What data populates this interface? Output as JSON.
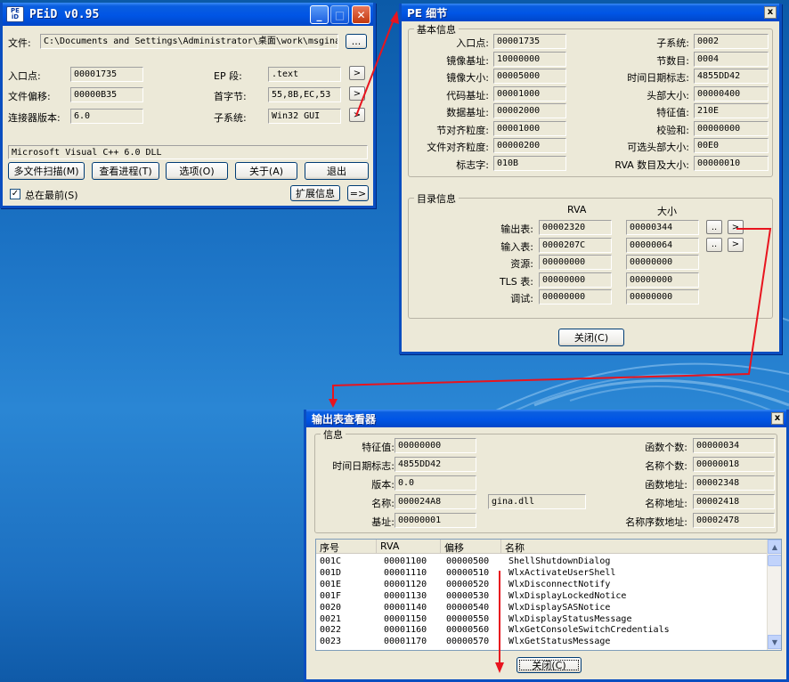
{
  "main": {
    "title": "PEiD v0.95",
    "logo": "PE iD",
    "minimize_glyph": "_",
    "maximize_glyph": "□",
    "close_glyph": "✕",
    "file_label": "文件:",
    "file_path": "C:\\Documents and Settings\\Administrator\\桌面\\work\\msgina.dll",
    "browse_label": "...",
    "entry_label": "入口点:",
    "entry_value": "00001735",
    "ep_section_label": "EP 段:",
    "ep_section_value": ".text",
    "file_offset_label": "文件偏移:",
    "file_offset_value": "00000B35",
    "first_bytes_label": "首字节:",
    "first_bytes_value": "55,8B,EC,53",
    "linker_label": "连接器版本:",
    "linker_value": "6.0",
    "subsystem_label": "子系统:",
    "subsystem_value": "Win32 GUI",
    "arrow_glyph": ">",
    "detection": "Microsoft Visual C++ 6.0 DLL",
    "btn_multiscan": "多文件扫描(M)",
    "btn_process": "查看进程(T)",
    "btn_options": "选项(O)",
    "btn_about": "关于(A)",
    "btn_exit": "退出",
    "check_mark": "✓",
    "stay_on_top": "总在最前(S)",
    "btn_ext_info": "扩展信息",
    "btn_next": "=>"
  },
  "pe": {
    "title": "PE 细节",
    "close_glyph": "x",
    "basic_group": "基本信息",
    "left_fields": [
      {
        "label": "入口点:",
        "value": "00001735"
      },
      {
        "label": "镜像基址:",
        "value": "10000000"
      },
      {
        "label": "镜像大小:",
        "value": "00005000"
      },
      {
        "label": "代码基址:",
        "value": "00001000"
      },
      {
        "label": "数据基址:",
        "value": "00002000"
      },
      {
        "label": "节对齐粒度:",
        "value": "00001000"
      },
      {
        "label": "文件对齐粒度:",
        "value": "00000200"
      },
      {
        "label": "标志字:",
        "value": "010B"
      }
    ],
    "right_fields": [
      {
        "label": "子系统:",
        "value": "0002"
      },
      {
        "label": "节数目:",
        "value": "0004"
      },
      {
        "label": "时间日期标志:",
        "value": "4855DD42"
      },
      {
        "label": "头部大小:",
        "value": "00000400"
      },
      {
        "label": "特征值:",
        "value": "210E"
      },
      {
        "label": "校验和:",
        "value": "00000000"
      },
      {
        "label": "可选头部大小:",
        "value": "00E0"
      },
      {
        "label": "RVA 数目及大小:",
        "value": "00000010"
      }
    ],
    "dir_group": "目录信息",
    "col_rva": "RVA",
    "col_size": "大小",
    "dirs": [
      {
        "label": "输出表:",
        "rva": "00002320",
        "size": "00000344"
      },
      {
        "label": "输入表:",
        "rva": "0000207C",
        "size": "00000064"
      },
      {
        "label": "资源:",
        "rva": "00000000",
        "size": "00000000"
      },
      {
        "label": "TLS 表:",
        "rva": "00000000",
        "size": "00000000"
      },
      {
        "label": "调试:",
        "rva": "00000000",
        "size": "00000000"
      }
    ],
    "dots_glyph": "..",
    "arrow_glyph": ">",
    "close_button": "关闭(C)"
  },
  "exp": {
    "title": "输出表查看器",
    "close_glyph": "x",
    "info_group": "信息",
    "characteristics_label": "特征值:",
    "characteristics_value": "00000000",
    "timestamp_label": "时间日期标志:",
    "timestamp_value": "4855DD42",
    "version_label": "版本:",
    "version_value": "0.0",
    "name_label": "名称:",
    "name_value": "000024A8",
    "name_string": "gina.dll",
    "base_label": "基址:",
    "base_value": "00000001",
    "num_funcs_label": "函数个数:",
    "num_funcs_value": "00000034",
    "num_names_label": "名称个数:",
    "num_names_value": "00000018",
    "func_addr_label": "函数地址:",
    "func_addr_value": "00002348",
    "name_addr_label": "名称地址:",
    "name_addr_value": "00002418",
    "ord_addr_label": "名称序数地址:",
    "ord_addr_value": "00002478",
    "columns": [
      "序号",
      "RVA",
      "偏移",
      "名称"
    ],
    "rows": [
      [
        "001C",
        "00001100",
        "00000500",
        "ShellShutdownDialog"
      ],
      [
        "001D",
        "00001110",
        "00000510",
        "WlxActivateUserShell"
      ],
      [
        "001E",
        "00001120",
        "00000520",
        "WlxDisconnectNotify"
      ],
      [
        "001F",
        "00001130",
        "00000530",
        "WlxDisplayLockedNotice"
      ],
      [
        "0020",
        "00001140",
        "00000540",
        "WlxDisplaySASNotice"
      ],
      [
        "0021",
        "00001150",
        "00000550",
        "WlxDisplayStatusMessage"
      ],
      [
        "0022",
        "00001160",
        "00000560",
        "WlxGetConsoleSwitchCredentials"
      ],
      [
        "0023",
        "00001170",
        "00000570",
        "WlxGetStatusMessage"
      ]
    ],
    "scroll_up_glyph": "▲",
    "scroll_down_glyph": "▼",
    "close_button": "关闭(C)"
  },
  "colors": {
    "annotation": "#e8141e",
    "titlebar": "#0055e5",
    "dialog_bg": "#ece9d8"
  }
}
